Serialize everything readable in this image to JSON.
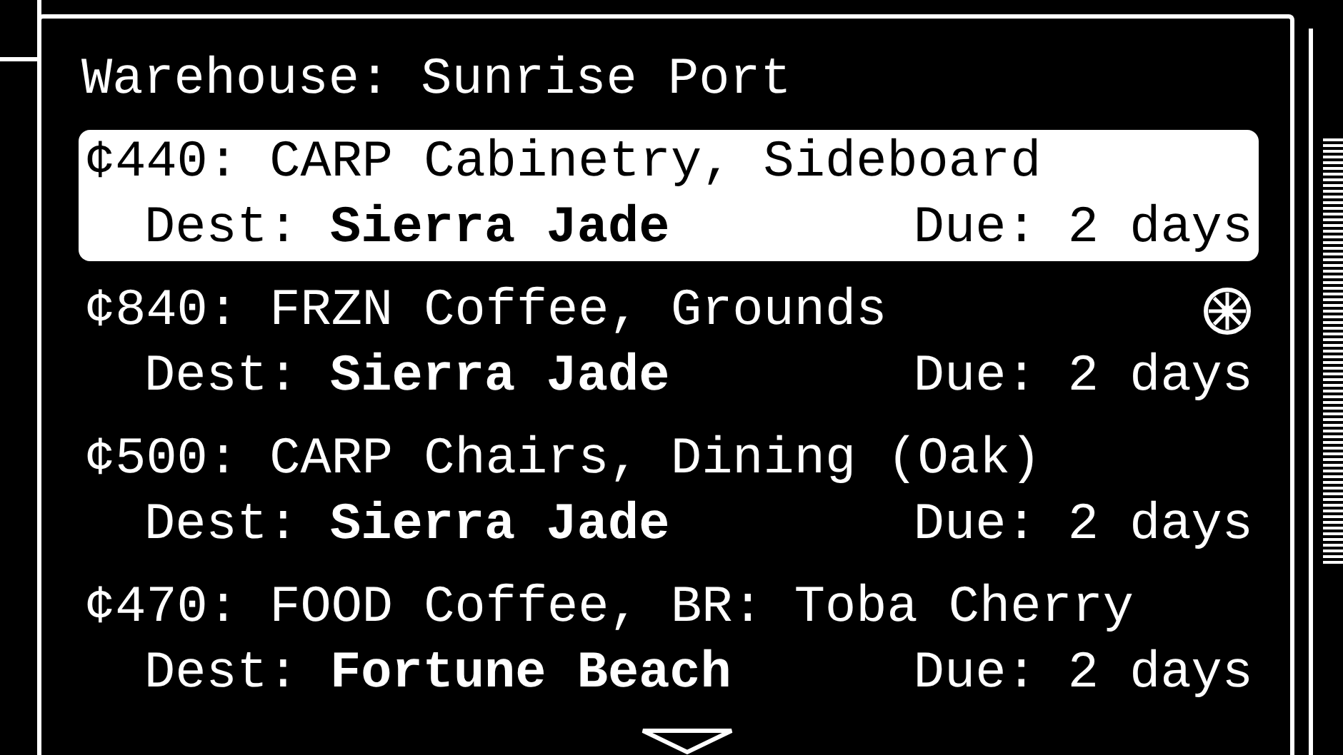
{
  "panel": {
    "title": "Warehouse: Sunrise Port"
  },
  "orders": [
    {
      "title": "¢440: CARP Cabinetry, Sideboard",
      "dest_label": "Dest:",
      "dest": "Sierra Jade",
      "due": "Due: 2 days",
      "selected": true,
      "refrigerated": false
    },
    {
      "title": "¢840: FRZN Coffee, Grounds",
      "dest_label": "Dest:",
      "dest": "Sierra Jade",
      "due": "Due: 2 days",
      "selected": false,
      "refrigerated": true
    },
    {
      "title": "¢500: CARP Chairs, Dining (Oak)",
      "dest_label": "Dest:",
      "dest": "Sierra Jade",
      "due": "Due: 2 days",
      "selected": false,
      "refrigerated": false
    },
    {
      "title": "¢470: FOOD Coffee, BR: Toba Cherry",
      "dest_label": "Dest:",
      "dest": "Fortune Beach",
      "due": "Due: 2 days",
      "selected": false,
      "refrigerated": false
    }
  ]
}
